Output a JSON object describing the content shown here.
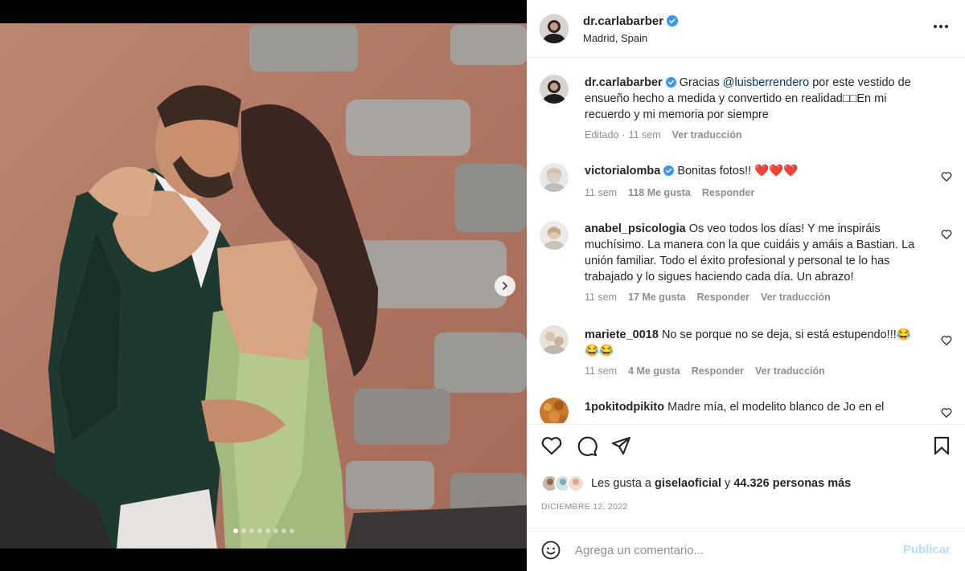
{
  "post": {
    "username": "dr.carlabarber",
    "location": "Madrid, Spain",
    "verified": true,
    "carousel_total": 8,
    "carousel_current": 1
  },
  "caption": {
    "username": "dr.carlabarber",
    "text_before": "Gracias ",
    "mention": "@luisberrendero",
    "text_after": " por este vestido de ensueño hecho a medida y convertido en realidad□□En mi recuerdo y mi memoria por siempre",
    "edited": "Editado",
    "time": "11 sem",
    "translate": "Ver traducción"
  },
  "comments": [
    {
      "username": "victorialomba",
      "verified": true,
      "text": "Bonitas fotos!! ❤️❤️❤️",
      "time": "11 sem",
      "likes": "118 Me gusta",
      "reply": "Responder",
      "translate": ""
    },
    {
      "username": "anabel_psicologia",
      "verified": false,
      "text": "Os veo todos los días! Y me inspiráis muchísimo. La manera con la que cuidáis y amáis a Bastian. La unión familiar. Todo el éxito profesional y personal te lo has trabajado y lo sigues haciendo cada día. Un abrazo!",
      "time": "11 sem",
      "likes": "17 Me gusta",
      "reply": "Responder",
      "translate": "Ver traducción"
    },
    {
      "username": "mariete_0018",
      "verified": false,
      "text": "No se porque no se deja, si está estupendo!!!😂😂😂",
      "time": "11 sem",
      "likes": "4 Me gusta",
      "reply": "Responder",
      "translate": "Ver traducción"
    },
    {
      "username": "1pokitodpikito",
      "verified": false,
      "text": "Madre mía, el modelito blanco de Jo en el",
      "time": "",
      "likes": "",
      "reply": "",
      "translate": ""
    }
  ],
  "likes": {
    "prefix": "Les gusta a ",
    "user": "giselaoficial",
    "middle": " y ",
    "count": "44.326 personas más"
  },
  "date": "DICIEMBRE 12, 2022",
  "composer": {
    "placeholder": "Agrega un comentario...",
    "publish": "Publicar"
  },
  "colors": {
    "verified": "#3897f0",
    "mention": "#00376b",
    "muted": "#8e8e8e",
    "publish_disabled": "#b2dffc"
  },
  "icons": [
    "heart-icon",
    "comment-icon",
    "share-icon",
    "bookmark-icon",
    "more-icon",
    "emoji-icon",
    "chevron-right-icon",
    "verified-icon"
  ]
}
